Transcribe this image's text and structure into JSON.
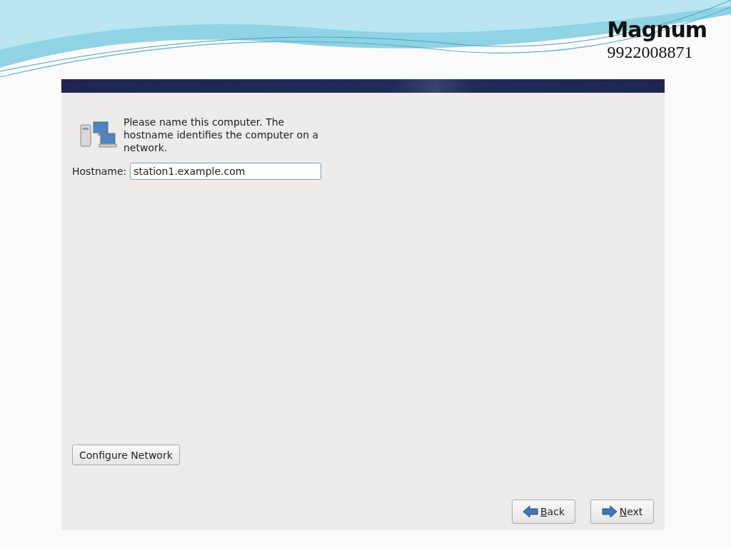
{
  "slide": {
    "title": "Magnum",
    "subtitle": "9922008871"
  },
  "installer": {
    "intro": "Please name this computer.  The hostname identifies the computer on a network.",
    "hostname_field": {
      "label": "Hostname:",
      "value": "station1.example.com"
    },
    "configure_button": "Configure Network",
    "nav_buttons": [
      {
        "kind": "back",
        "mnemonic": "B",
        "rest": "ack"
      },
      {
        "kind": "next",
        "mnemonic": "N",
        "rest": "ext"
      }
    ]
  }
}
